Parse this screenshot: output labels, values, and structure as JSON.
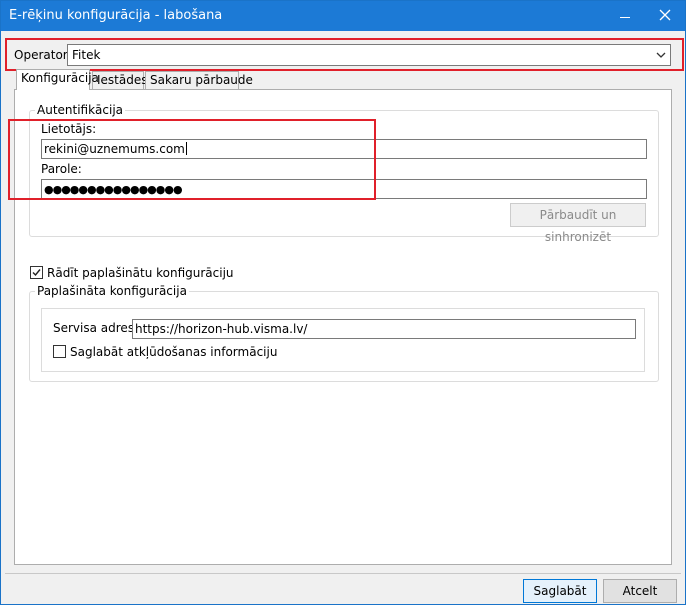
{
  "window": {
    "title": "E-rēķinu konfigurācija - labošana",
    "accent": "#1c7ad6"
  },
  "operator": {
    "label": "Operators",
    "value": "Fitek"
  },
  "tabs": [
    {
      "label": "Konfigurācija",
      "active": true
    },
    {
      "label": "Iestādes",
      "active": false
    },
    {
      "label": "Sakaru pārbaude",
      "active": false
    }
  ],
  "auth": {
    "caption": "Autentifikācija",
    "user_label": "Lietotājs:",
    "user_value": "rekini@uznemums.com",
    "password_label": "Parole:",
    "password_value": "●●●●●●●●●●●●●●●●",
    "verify_button": "Pārbaudīt un sinhronizēt"
  },
  "advanced": {
    "show_checkbox_label": "Rādīt paplašinātu konfigurāciju",
    "show_checked": true,
    "caption": "Paplašināta konfigurācija",
    "service_label": "Servisa adrese:",
    "service_value": "https://horizon-hub.visma.lv/",
    "debug_checkbox_label": "Saglabāt atkļūdošanas informāciju",
    "debug_checked": false
  },
  "footer": {
    "save_button": "Saglabāt",
    "cancel_button": "Atcelt"
  },
  "highlight_color": "#e0202a"
}
